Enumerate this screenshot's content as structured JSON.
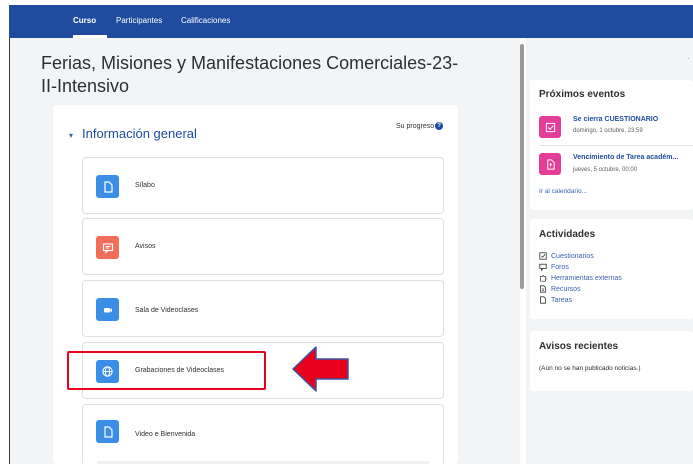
{
  "topbar": {
    "tabs": [
      {
        "label": "Curso",
        "active": true
      },
      {
        "label": "Participantes",
        "active": false
      },
      {
        "label": "Calificaciones",
        "active": false
      }
    ]
  },
  "course": {
    "title": "Ferias, Misiones y Manifestaciones Comerciales-23-II-Intensivo"
  },
  "section": {
    "toggle_glyph": "▾",
    "title": "Información general",
    "progress_label": "Su progreso",
    "help_glyph": "?"
  },
  "activities": [
    {
      "label": "Sílabo",
      "icon": "file-icon",
      "color": "#3a8ee6"
    },
    {
      "label": "Avisos",
      "icon": "forum-icon",
      "color": "#f06e5a"
    },
    {
      "label": "Sala de Videoclases",
      "icon": "video-icon",
      "color": "#3a8ee6"
    },
    {
      "label": "Grabaciones de Videoclases",
      "icon": "globe-icon",
      "color": "#3a8ee6"
    },
    {
      "label": "Video e Bienvenida",
      "icon": "file-icon",
      "color": "#3a8ee6"
    }
  ],
  "annotation": {
    "highlight_color": "#e8001c",
    "arrow_color": "#e8001c"
  },
  "sidebar": {
    "events": {
      "title": "Próximos eventos",
      "items": [
        {
          "title": "Se cierra CUESTIONARIO",
          "date": "domingo, 1 octubre, 23:59"
        },
        {
          "title": "Vencimiento de Tarea académ...",
          "date": "jueves, 5 octubre, 00:00"
        }
      ],
      "calendar_link": "Ir al calendario..."
    },
    "activities": {
      "title": "Actividades",
      "items": [
        {
          "label": "Cuestionarios",
          "icon": "quiz-icon"
        },
        {
          "label": "Foros",
          "icon": "forum-icon"
        },
        {
          "label": "Herramientas externas",
          "icon": "puzzle-icon"
        },
        {
          "label": "Recursos",
          "icon": "resource-icon"
        },
        {
          "label": "Tareas",
          "icon": "assignment-icon"
        }
      ]
    },
    "news": {
      "title": "Avisos recientes",
      "empty_text": "(Aún no se han publicado noticias.)"
    }
  },
  "colors": {
    "brand": "#1f4c9f",
    "event_accent": "#e53e9a"
  }
}
